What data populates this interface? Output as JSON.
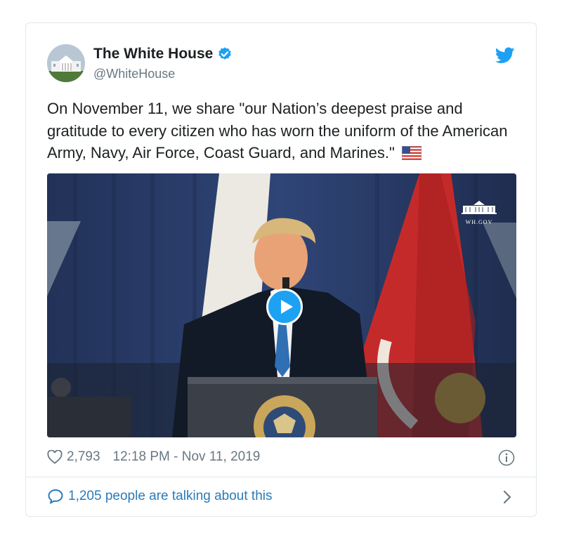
{
  "author": {
    "name": "The White House",
    "handle": "@WhiteHouse",
    "verified": true,
    "avatar_icon": "white-house-avatar"
  },
  "tweet": {
    "text": "On November 11, we share \"our Nation’s deepest praise and gratitude to every citizen who has worn the uniform of the American Army, Navy, Air Force, Coast Guard, and Marines.\"",
    "emoji": "us-flag-icon"
  },
  "media": {
    "type": "video",
    "watermark": "WH.GOV"
  },
  "meta": {
    "likes": "2,793",
    "timestamp": "12:18 PM - Nov 11, 2019"
  },
  "footer": {
    "talking": "1,205 people are talking about this"
  },
  "colors": {
    "accent": "#1da1f2",
    "link": "#2b7bb9",
    "muted": "#697882",
    "border": "#e1e8ed"
  }
}
